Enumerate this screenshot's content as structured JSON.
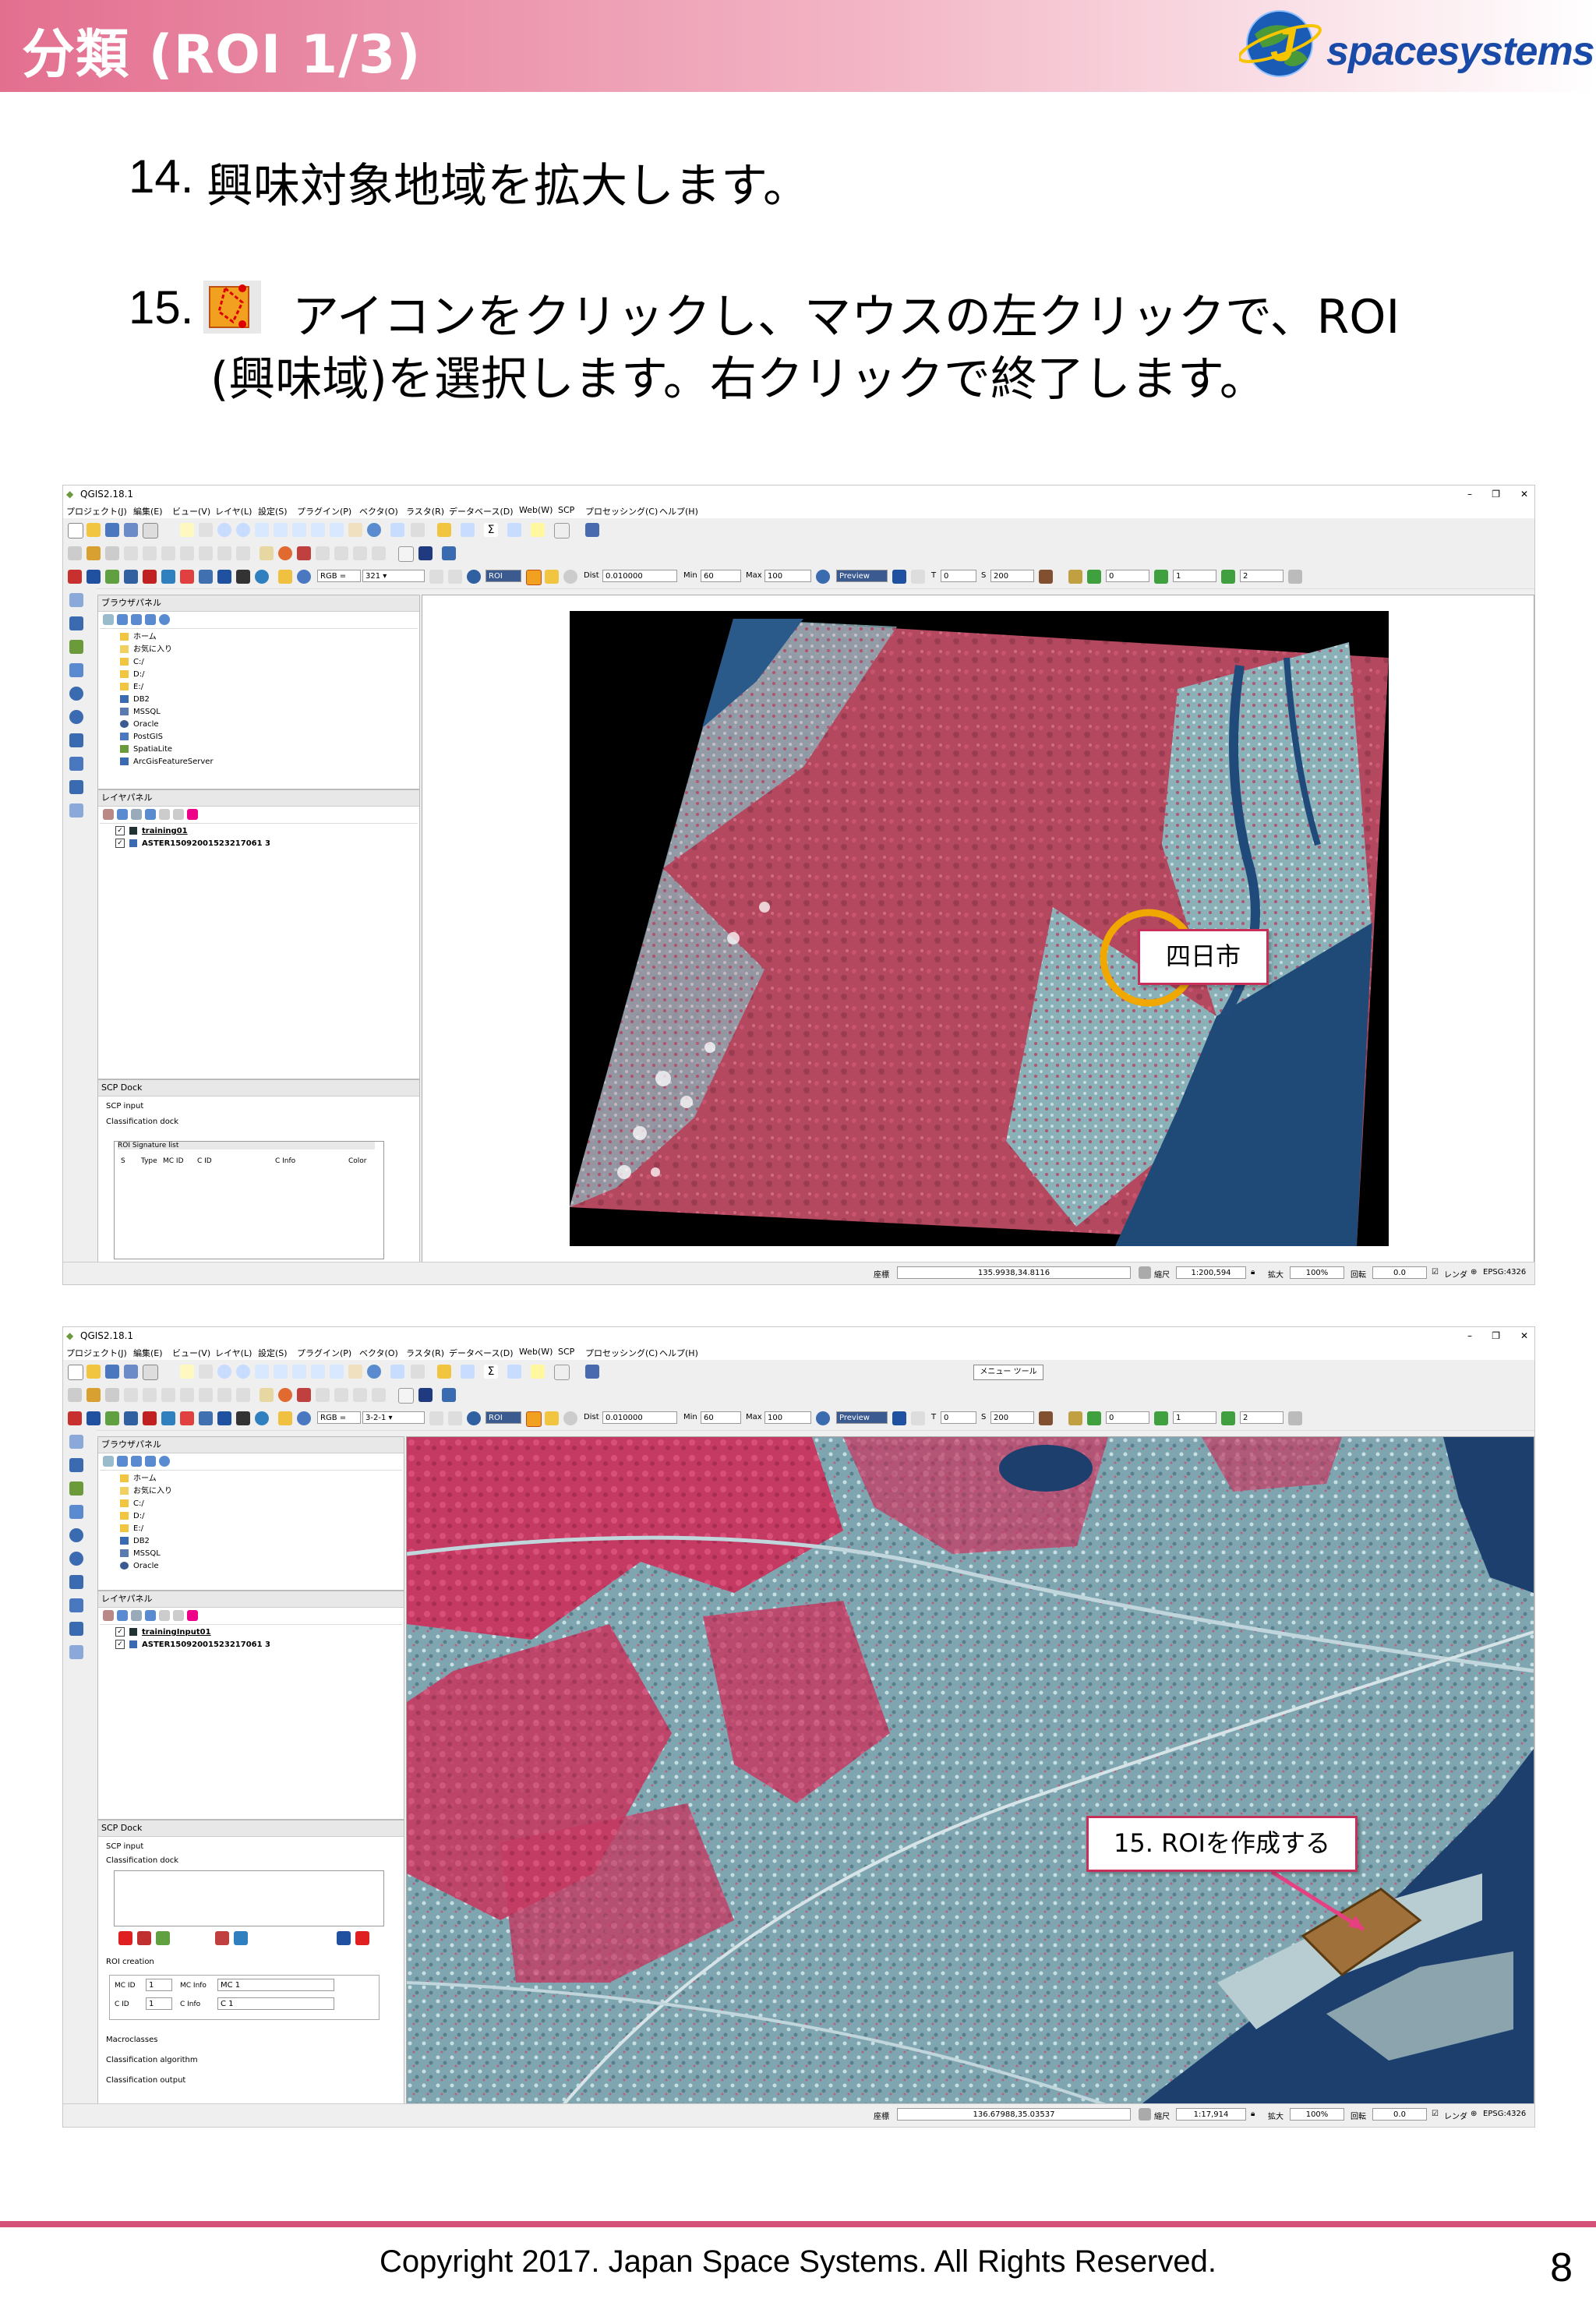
{
  "header": {
    "title": "分類 (ROI 1/3)",
    "logo_text": "spacesystems",
    "logo_letter": "J"
  },
  "steps": {
    "s14": {
      "num": "14.",
      "text": "興味対象地域を拡大します。"
    },
    "s15": {
      "num": "15.",
      "text_line1": "アイコンをクリックし、マウスの左クリックで、ROI",
      "text_line2": "(興味域)を選択します。右クリックで終了します。"
    }
  },
  "qgis": {
    "title": "QGIS2.18.1",
    "menu": [
      "プロジェクト(J)",
      "編集(E)",
      "ビュー(V)",
      "レイヤ(L)",
      "設定(S)",
      "プラグイン(P)",
      "ベクタ(O)",
      "ラスタ(R)",
      "データベース(D)",
      "Web(W)",
      "SCP",
      "プロセッシング(C)",
      "ヘルプ(H)"
    ],
    "toolbar": {
      "rgb_label": "RGB =",
      "dist_label": "Dist",
      "dist_value": "0.010000",
      "min_label": "Min",
      "min_value": "60",
      "max_label": "Max",
      "max_value": "100",
      "preview_label": "Preview",
      "t_label": "T",
      "t_value": "0",
      "s_label": "S",
      "s_value": "200",
      "band1": "0",
      "band2": "1",
      "band3": "2",
      "roi_label": "ROI"
    },
    "browser_panel": "ブラウザパネル",
    "layer_panel": "レイヤパネル",
    "scp_dock": "SCP Dock",
    "scp_input": "SCP input",
    "classification_dock": "Classification dock",
    "browser_items": [
      "ホーム",
      "お気に入り",
      "C:/",
      "D:/",
      "E:/",
      "DB2",
      "MSSQL",
      "Oracle",
      "PostGIS",
      "SpatiaLite",
      "ArcGisFeatureServer"
    ],
    "status": {
      "coord_label": "座標",
      "scale_label": "縮尺",
      "magnifier_label": "拡大",
      "magnifier_value": "100%",
      "rotation_label": "回転",
      "rotation_value": "0.0",
      "render_label": "レンダ",
      "crs": "EPSG:4326"
    }
  },
  "shot1": {
    "rgb_value": "321",
    "layers": [
      "training01",
      "ASTER15092001523217061 3"
    ],
    "roi_list_title": "ROI Signature list",
    "roi_list_headers": [
      "S",
      "Type",
      "MC ID",
      "C ID",
      "C Info",
      "Color"
    ],
    "coord_value": "135.9938,34.8116",
    "scale_value": "1:200,594",
    "callout": "四日市"
  },
  "shot2": {
    "rgb_value": "3-2-1",
    "tooltip": "メニュー ツール",
    "layers": [
      "trainingInput01",
      "ASTER15092001523217061 3"
    ],
    "roi_creation": "ROI creation",
    "mc_id_label": "MC ID",
    "mc_id_value": "1",
    "mc_info_label": "MC Info",
    "mc_info_value": "MC 1",
    "c_id_label": "C ID",
    "c_id_value": "1",
    "c_info_label": "C Info",
    "c_info_value": "C 1",
    "macroclasses": "Macroclasses",
    "classification_algorithm": "Classification algorithm",
    "classification_output": "Classification output",
    "coord_value": "136.67988,35.03537",
    "scale_value": "1:17,914",
    "callout": "15. ROIを作成する"
  },
  "footer": {
    "copyright": "Copyright 2017. Japan Space Systems. All Rights Reserved.",
    "page": "8"
  },
  "colors": {
    "accent": "#c7305a",
    "header_pink": "#e36f8f",
    "roi_fill": "#a0703a",
    "circle": "#f0a800"
  }
}
